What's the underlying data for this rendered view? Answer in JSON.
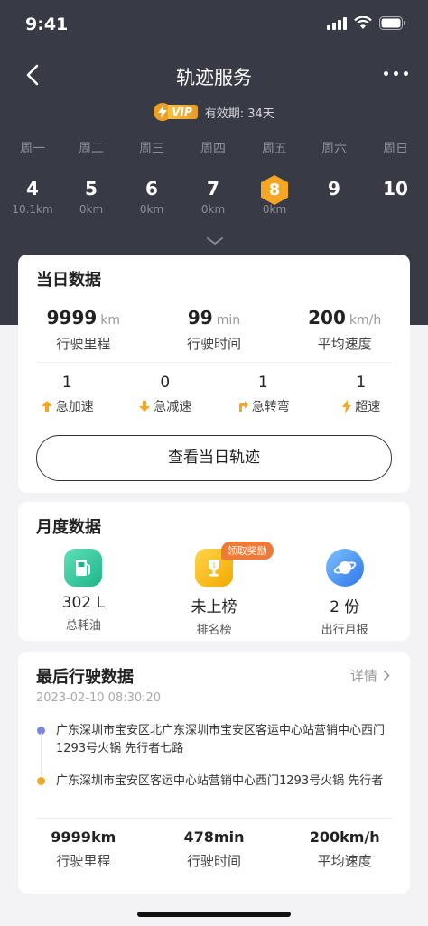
{
  "status": {
    "time": "9:41"
  },
  "header": {
    "title": "轨迹服务",
    "vip_label": "VIP",
    "validity": "有效期: 34天"
  },
  "week": [
    {
      "weekday": "周一",
      "date": "4",
      "km": "10.1km",
      "active": false
    },
    {
      "weekday": "周二",
      "date": "5",
      "km": "0km",
      "active": false
    },
    {
      "weekday": "周三",
      "date": "6",
      "km": "0km",
      "active": false
    },
    {
      "weekday": "周四",
      "date": "7",
      "km": "0km",
      "active": false
    },
    {
      "weekday": "周五",
      "date": "8",
      "km": "0km",
      "active": true
    },
    {
      "weekday": "周六",
      "date": "9",
      "km": "",
      "active": false
    },
    {
      "weekday": "周日",
      "date": "10",
      "km": "",
      "active": false
    }
  ],
  "daily": {
    "title": "当日数据",
    "stats": [
      {
        "value": "9999",
        "unit": "km",
        "label": "行驶里程"
      },
      {
        "value": "99",
        "unit": "min",
        "label": "行驶时间"
      },
      {
        "value": "200",
        "unit": "km/h",
        "label": "平均速度"
      }
    ],
    "events": [
      {
        "count": "1",
        "label": "急加速",
        "icon": "accelerate-icon"
      },
      {
        "count": "0",
        "label": "急减速",
        "icon": "decelerate-icon"
      },
      {
        "count": "1",
        "label": "急转弯",
        "icon": "sharp-turn-icon"
      },
      {
        "count": "1",
        "label": "超速",
        "icon": "overspeed-icon"
      }
    ],
    "button": "查看当日轨迹"
  },
  "monthly": {
    "title": "月度数据",
    "items": [
      {
        "value": "302 L",
        "label": "总耗油",
        "icon": "fuel-pump-icon",
        "color": "#2ec29a"
      },
      {
        "value": "未上榜",
        "label": "排名榜",
        "icon": "trophy-icon",
        "color": "#f5b400"
      },
      {
        "value": "2 份",
        "label": "出行月报",
        "icon": "planet-icon",
        "color": "#3f8cf5"
      }
    ],
    "reward_tag": "领取奖励"
  },
  "last_trip": {
    "title": "最后行驶数据",
    "detail": "详情",
    "datetime": "2023-02-10 08:30:20",
    "start": "广东深圳市宝安区北广东深圳市宝安区客运中心站营销中心西门1293号火锅 先行者七路",
    "end": "广东深圳市宝安区客运中心站营销中心西门1293号火锅 先行者",
    "stats": [
      {
        "value": "9999km",
        "label": "行驶里程"
      },
      {
        "value": "478min",
        "label": "行驶时间"
      },
      {
        "value": "200km/h",
        "label": "平均速度"
      }
    ]
  },
  "colors": {
    "dark_header": "#383b45",
    "accent": "#f5a623",
    "start_dot": "#7a86e6",
    "end_dot": "#f5a623"
  }
}
